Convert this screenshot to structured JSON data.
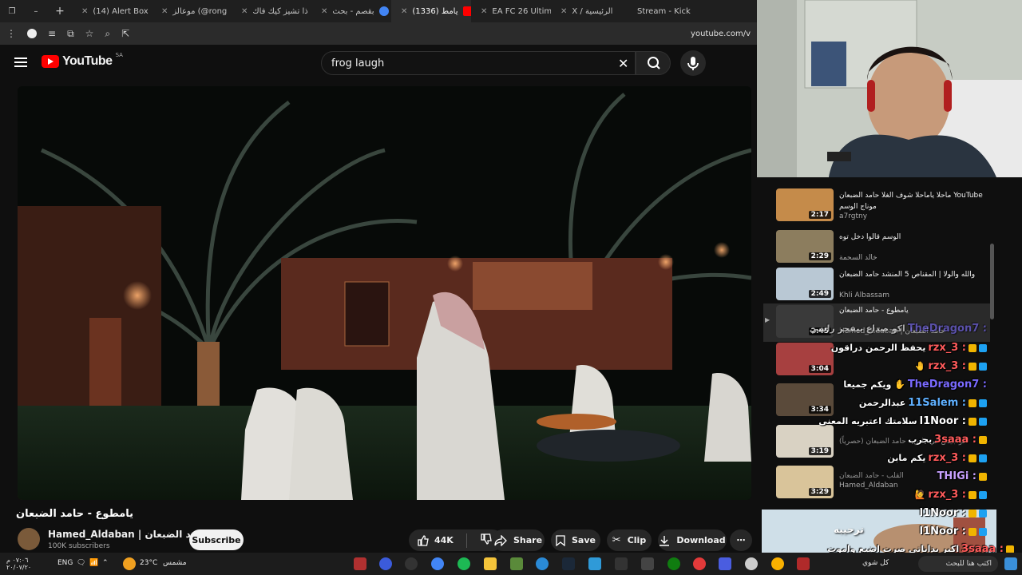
{
  "browser": {
    "tabs": [
      {
        "label": "(14) Alert Box",
        "color": "#8ab4f8"
      },
      {
        "label": "",
        "color": "#33cc66"
      },
      {
        "label": "موعالز (@rong",
        "color": "#222222"
      },
      {
        "label": "ذا تشيز كيك فاك",
        "color": "#4caf50"
      },
      {
        "label": "بقصم - بحث",
        "color": "#4285f4"
      },
      {
        "label": "(1336) يامط",
        "color": "#ff0000",
        "active": true
      },
      {
        "label": "EA FC 26 Ultim",
        "color": "#1db954"
      },
      {
        "label": "X / الرئيسية",
        "color": "#ffffff"
      },
      {
        "label": "Stream - Kick",
        "color": "#53fc18"
      }
    ],
    "url": "youtube.com/v"
  },
  "youtube": {
    "logo_text": "YouTube",
    "country": "SA",
    "search_query": "frog laugh"
  },
  "video": {
    "title": "يامطوع - حامد الضبعان",
    "channel": "Hamed_Aldaban | حامد الضبعان",
    "subscribers": "100K subscribers",
    "subscribe_label": "Subscribe",
    "likes": "44K",
    "share_label": "Share",
    "save_label": "Save",
    "clip_label": "Clip",
    "download_label": "Download"
  },
  "playlist": [
    {
      "title": "ماحلا ياماحلا شوف الغلا حامد الضبعان YouTube موناج الوسم",
      "channel": "a7rgtny",
      "duration": "2:17",
      "thumb": "#c58b4a"
    },
    {
      "title": "الوسم قالوا دخل توه",
      "channel": "خالد السحمة",
      "duration": "2:29",
      "thumb": "#8c7d5e"
    },
    {
      "title": "والله والولا | المقناص 5 المنشد حامد الضبعان",
      "channel": "Khli Albassam",
      "duration": "2:49",
      "thumb": "#b9c8d4"
    },
    {
      "title": "يامطوع - حامد الضبعان",
      "channel": "Hamed_Aldaban | حامد الضبعان",
      "duration": "2:45",
      "thumb": "#3a3a3a",
      "active": true
    },
    {
      "title": "",
      "channel": "",
      "duration": "3:04",
      "thumb": "#a74040"
    },
    {
      "title": "",
      "channel": "",
      "duration": "3:34",
      "thumb": "#5a4a3a"
    },
    {
      "title": "هواجيس في قلبي - حامد الضبعان (حصرياً)",
      "channel": "",
      "duration": "3:19",
      "thumb": "#d9d2c3"
    },
    {
      "title": "القلب - حامد الضبعان",
      "channel": "Hamed_Aldaban",
      "duration": "3:29",
      "thumb": "#d9c49a"
    }
  ],
  "chat": [
    {
      "text": "اكو صداع بيفجر راسي",
      "name": "TheDragon7 :"
    },
    {
      "text": "يحفظ الرحمن دراقون",
      "name": "rzx_3 :"
    },
    {
      "text": "🤚",
      "name": "rzx_3 :"
    },
    {
      "text": "ويكم جميعا ✋",
      "name": "TheDragon7 :"
    },
    {
      "text": "عبدالرحمن",
      "name": "11Salem :"
    },
    {
      "text": "سلامتك اعتبريه المعنى",
      "name": "l1Noor :"
    },
    {
      "text": "بجرب",
      "name": "3saaa :"
    },
    {
      "text": "يكم مابن",
      "name": "rzx_3 :"
    },
    {
      "text": "",
      "name": "THIGi :"
    },
    {
      "text": "🙋",
      "name": "rzx_3 :"
    },
    {
      "text": "",
      "name": "l1Noor :"
    },
    {
      "text": "",
      "name": "l1Noor :"
    },
    {
      "text": "اكبر بداياتي صرت اضيع واموت",
      "name": "3saaa :"
    }
  ],
  "bottom_thumb_text": "ترحيبه",
  "taskbar": {
    "weather": "23°C",
    "weather_label": "مشمس",
    "lang": "ENG",
    "time": "٠٧:٠٦ م",
    "date": "٢٠/٠٧/٢٠",
    "search_placeholder": "اكتب هنا للبحث",
    "chat_text": "كل شوي"
  }
}
